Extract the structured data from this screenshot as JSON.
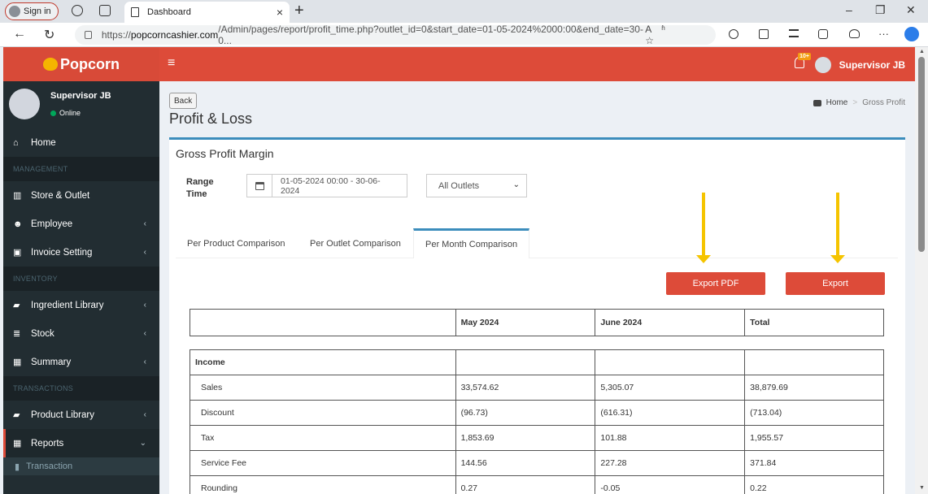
{
  "browser": {
    "signin_label": "Sign in",
    "tab_title": "Dashboard",
    "tab_close": "×",
    "new_tab": "+",
    "url_prefix": "https://",
    "url_host": "popcorncashier.com",
    "url_rest": "/Admin/pages/report/profit_time.php?outlet_id=0&start_date=01-05-2024%2000:00&end_date=30-0...",
    "url_tools": "Aʱ ☆",
    "minimize": "–",
    "restore": "❐",
    "close": "✕",
    "back_glyph": "←",
    "reload_glyph": "↻",
    "more_glyph": "···"
  },
  "app": {
    "logo_text": "Popcorn",
    "menu_icon": "≡",
    "notif_badge": "10+",
    "user_name": "Supervisor JB"
  },
  "sidebar": {
    "user_name": "Supervisor JB",
    "user_status": "Online",
    "items": [
      {
        "type": "item",
        "label": "Home",
        "icon": "home-icon",
        "glyph": "⌂",
        "chevron": ""
      },
      {
        "type": "header",
        "label": "MANAGEMENT"
      },
      {
        "type": "item",
        "label": "Store & Outlet",
        "icon": "bank-icon",
        "glyph": "▥",
        "chevron": ""
      },
      {
        "type": "item",
        "label": "Employee",
        "icon": "users-icon",
        "glyph": "☻",
        "chevron": "‹"
      },
      {
        "type": "item",
        "label": "Invoice Setting",
        "icon": "money-icon",
        "glyph": "▣",
        "chevron": "‹"
      },
      {
        "type": "header",
        "label": "INVENTORY"
      },
      {
        "type": "item",
        "label": "Ingredient Library",
        "icon": "book-icon",
        "glyph": "▰",
        "chevron": "‹"
      },
      {
        "type": "item",
        "label": "Stock",
        "icon": "database-icon",
        "glyph": "≣",
        "chevron": "‹"
      },
      {
        "type": "item",
        "label": "Summary",
        "icon": "table-icon",
        "glyph": "▦",
        "chevron": "‹"
      },
      {
        "type": "header",
        "label": "TRANSACTIONS"
      },
      {
        "type": "item",
        "label": "Product Library",
        "icon": "book-icon",
        "glyph": "▰",
        "chevron": "‹"
      },
      {
        "type": "item",
        "label": "Reports",
        "icon": "table-icon",
        "glyph": "▦",
        "chevron": "⌄",
        "active": true
      },
      {
        "type": "sub",
        "label": "Transaction",
        "icon": "bar-chart-icon",
        "glyph": "▮"
      }
    ]
  },
  "content": {
    "back_label": "Back",
    "page_title": "Profit & Loss",
    "breadcrumb_home": "Home",
    "breadcrumb_sep": ">",
    "breadcrumb_current": "Gross Profit",
    "box_title": "Gross Profit Margin",
    "range_label_1": "Range",
    "range_label_2": "Time",
    "date_range": "01-05-2024 00:00 - 30-06-2024",
    "outlet_selected": "All Outlets",
    "tabs": [
      "Per Product Comparison",
      "Per Outlet Comparison",
      "Per Month Comparison"
    ],
    "active_tab": 2,
    "export_pdf_label": "Export PDF",
    "export_label": "Export"
  },
  "table": {
    "headers": [
      "",
      "May 2024",
      "June 2024",
      "Total"
    ],
    "group_label": "Income",
    "rows": [
      {
        "label": "Sales",
        "may": "33,574.62",
        "june": "5,305.07",
        "total": "38,879.69"
      },
      {
        "label": "Discount",
        "may": "(96.73)",
        "june": "(616.31)",
        "total": "(713.04)"
      },
      {
        "label": "Tax",
        "may": "1,853.69",
        "june": "101.88",
        "total": "1,955.57"
      },
      {
        "label": "Service Fee",
        "may": "144.56",
        "june": "227.28",
        "total": "371.84"
      },
      {
        "label": "Rounding",
        "may": "0.27",
        "june": "-0.05",
        "total": "0.22"
      }
    ]
  },
  "colors": {
    "header_red": "#dd4b39",
    "sidebar_dark": "#222d32",
    "accent_blue": "#3c8dbc",
    "annotation_arrow": "#f5c400"
  }
}
